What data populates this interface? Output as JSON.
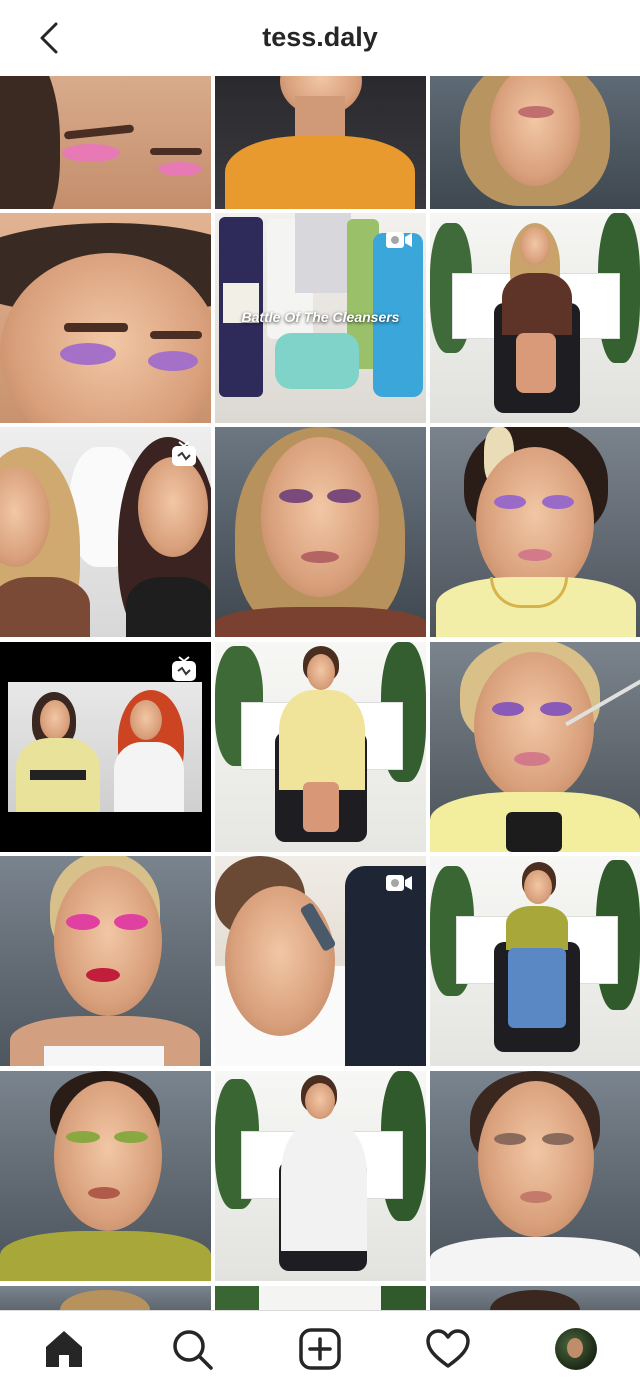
{
  "header": {
    "title": "tess.daly",
    "back_icon": "chevron-left-icon"
  },
  "grid": {
    "video_badge_icon": "video-camera-icon",
    "igtv_badge_icon": "igtv-icon",
    "cleanser_caption": "Battle Of The Cleansers"
  },
  "nav": {
    "items": [
      {
        "icon": "home-icon",
        "active": true
      },
      {
        "icon": "search-icon"
      },
      {
        "icon": "new-post-icon"
      },
      {
        "icon": "activity-heart-icon"
      },
      {
        "icon": "profile-avatar"
      }
    ]
  },
  "colors": {
    "text": "#262626",
    "divider": "#dbdbdb",
    "background": "#ffffff"
  }
}
